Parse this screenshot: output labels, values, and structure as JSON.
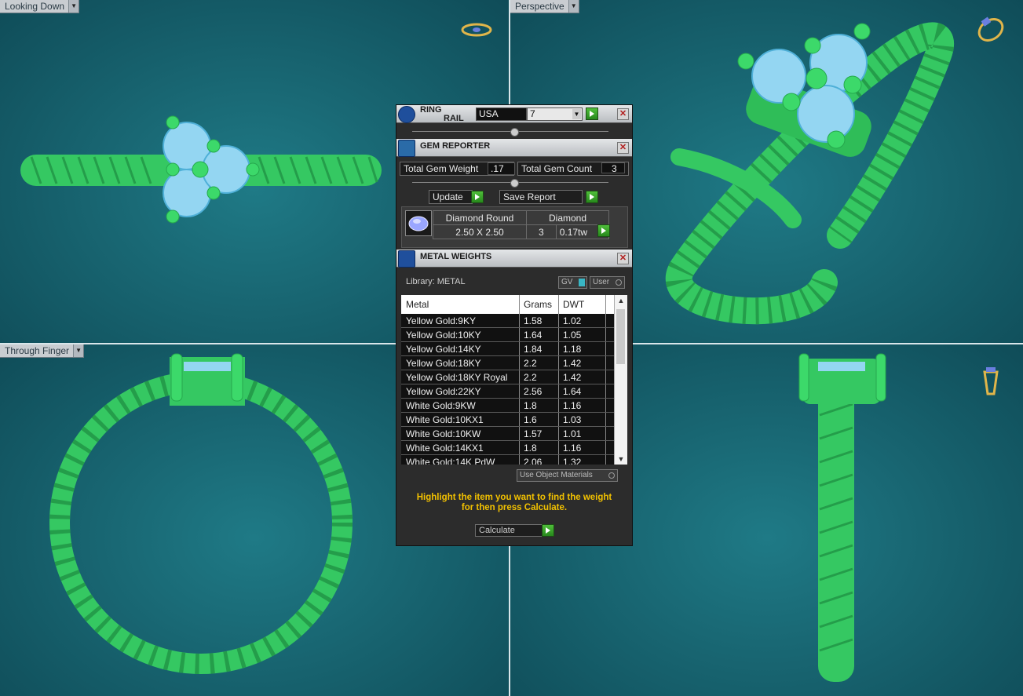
{
  "viewports": {
    "top_left": {
      "label": "Looking Down"
    },
    "top_right": {
      "label": "Perspective"
    },
    "bottom_left": {
      "label": "Through Finger"
    }
  },
  "ring_rail": {
    "title_line1": "RING",
    "title_line2": "RAIL",
    "region": "USA",
    "size": "7"
  },
  "gem_reporter": {
    "title": "GEM REPORTER",
    "total_gem_weight_label": "Total Gem Weight",
    "total_gem_weight": ".17",
    "total_gem_count_label": "Total Gem Count",
    "total_gem_count": "3",
    "update_label": "Update",
    "save_report_label": "Save Report",
    "gem": {
      "shape": "Diamond Round",
      "type": "Diamond",
      "dimensions": "2.50 X 2.50",
      "count": "3",
      "weight": "0.17tw"
    }
  },
  "metal_weights": {
    "title": "METAL WEIGHTS",
    "library_label": "Library: METAL",
    "gv_label": "GV",
    "user_label": "User",
    "columns": [
      "Metal",
      "Grams",
      "DWT"
    ],
    "rows": [
      {
        "metal": "Yellow Gold:9KY",
        "grams": "1.58",
        "dwt": "1.02"
      },
      {
        "metal": "Yellow Gold:10KY",
        "grams": "1.64",
        "dwt": "1.05"
      },
      {
        "metal": "Yellow Gold:14KY",
        "grams": "1.84",
        "dwt": "1.18"
      },
      {
        "metal": "Yellow Gold:18KY",
        "grams": "2.2",
        "dwt": "1.42"
      },
      {
        "metal": "Yellow Gold:18KY Royal",
        "grams": "2.2",
        "dwt": "1.42"
      },
      {
        "metal": "Yellow Gold:22KY",
        "grams": "2.56",
        "dwt": "1.64"
      },
      {
        "metal": "White Gold:9KW",
        "grams": "1.8",
        "dwt": "1.16"
      },
      {
        "metal": "White Gold:10KX1",
        "grams": "1.6",
        "dwt": "1.03"
      },
      {
        "metal": "White Gold:10KW",
        "grams": "1.57",
        "dwt": "1.01"
      },
      {
        "metal": "White Gold:14KX1",
        "grams": "1.8",
        "dwt": "1.16"
      },
      {
        "metal": "White Gold:14K PdW",
        "grams": "2.06",
        "dwt": "1.32"
      }
    ],
    "use_object_materials_label": "Use Object Materials",
    "message_line1": "Highlight the item you want to find the weight",
    "message_line2": "for then press Calculate.",
    "calculate_label": "Calculate"
  },
  "colors": {
    "ring_green": "#3cd96a",
    "gem_blue": "#8fd3f2",
    "viewport_bg": "#186571",
    "message_yellow": "#f2c100"
  }
}
